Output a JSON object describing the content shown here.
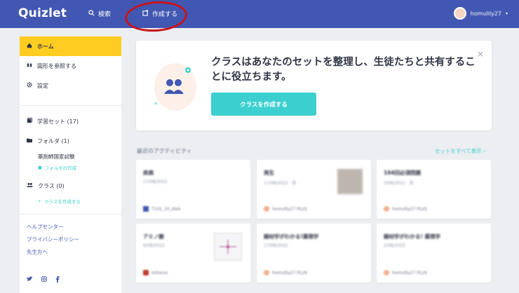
{
  "topbar": {
    "logo": "Quizlet",
    "search_label": "検索",
    "create_label": "作成する",
    "username": "homulily27",
    "bg_color": "#4257b2"
  },
  "sidebar": {
    "nav": [
      {
        "label": "ホーム",
        "icon": "home-icon",
        "active": true
      },
      {
        "label": "図形を参照する",
        "icon": "eye-icon"
      },
      {
        "label": "設定",
        "icon": "gear-icon"
      }
    ],
    "library": {
      "sets": "学習セット (17)",
      "folders": "フォルダ (1)",
      "folder_item": "薬剤師国家試験",
      "create_folder": "フォルダの作成",
      "classes": "クラス (0)",
      "create_class": "クラスを作成する"
    },
    "footer_links": [
      "ヘルプセンター",
      "プライバシーポリシー",
      "先生方へ"
    ],
    "social": [
      "twitter-icon",
      "instagram-icon",
      "facebook-icon"
    ]
  },
  "banner": {
    "title": "クラスはあなたのセットを整理し、生徒たちと共有することに役立ちます。",
    "button": "クラスを作成する",
    "close": "×"
  },
  "activity": {
    "title": "最近のアクティビティ",
    "see_all": "セットをすべて表示 ›",
    "cards": [
      {
        "title": "疾病",
        "date": "17/08/2022",
        "user": "T102_10_AAA"
      },
      {
        "title": "発生",
        "date": "17/08/2022 · 自",
        "user": "homulily27 PLUS"
      },
      {
        "title": "104回必須問題",
        "date": "3/08/2022 · 自",
        "user": "homulily27 PLUS"
      },
      {
        "title": "アミノ酸",
        "date": "6/08/2022",
        "user": "lottarus"
      },
      {
        "title": "雑材学がわかる!薬理学",
        "date": "17/08/2022",
        "user": "homulily27 PLUS"
      },
      {
        "title": "雑材学がわかる! 薬理学",
        "date": "2/08/2022",
        "user": "homulily27 PLUS"
      }
    ]
  }
}
